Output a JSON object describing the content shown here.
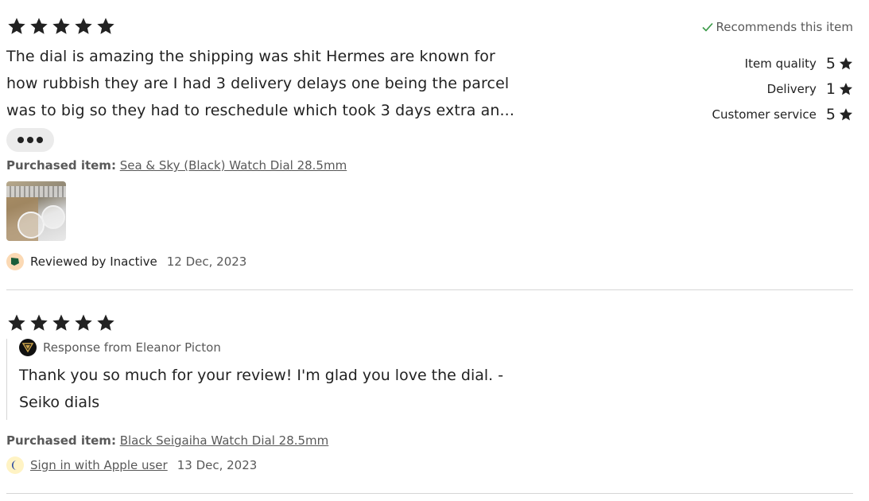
{
  "reviews": [
    {
      "rating": 5,
      "text": "The dial is amazing the shipping was shit Hermes are known for how rubbish they are I had 3 delivery delays one being the parcel was to big so they had to reschedule which took 3 days extra an...",
      "recommends": "Recommends this item",
      "sub_ratings": [
        {
          "label": "Item quality",
          "value": "5"
        },
        {
          "label": "Delivery",
          "value": "1"
        },
        {
          "label": "Customer service",
          "value": "5"
        }
      ],
      "purchased_label": "Purchased item:",
      "purchased_item": "Sea & Sky (Black) Watch Dial 28.5mm",
      "reviewer_prefix": "Reviewed by",
      "reviewer": "Inactive",
      "date": "12 Dec, 2023"
    },
    {
      "rating": 5,
      "response_from": "Response from Eleanor Picton",
      "response_text": "Thank you so much for your review! I'm glad you love the dial. - Seiko dials",
      "purchased_label": "Purchased item:",
      "purchased_item": "Black Seigaiha Watch Dial 28.5mm",
      "reviewer": "Sign in with Apple user",
      "date": "13 Dec, 2023"
    }
  ],
  "colors": {
    "star": "#222222",
    "check": "#258635",
    "muted": "#595959",
    "divider": "#d6d6d6"
  }
}
